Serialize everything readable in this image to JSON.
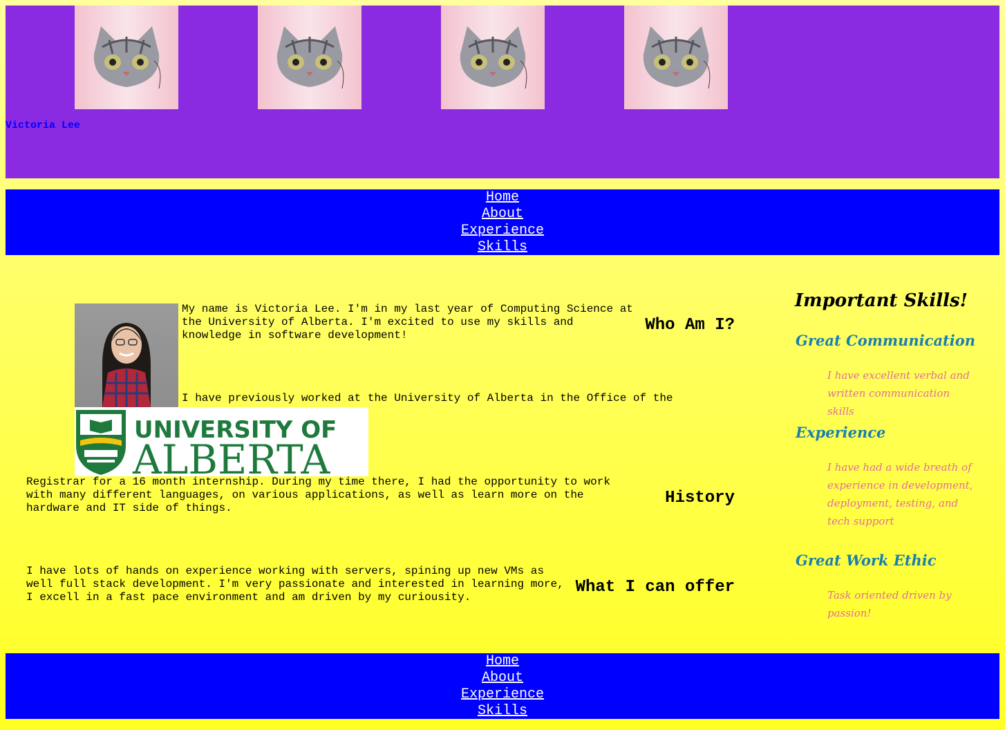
{
  "header": {
    "name": "Victoria Lee",
    "banner_images": [
      "cat-face-image",
      "cat-face-image",
      "cat-face-image",
      "cat-face-image"
    ]
  },
  "nav": {
    "items": [
      "Home",
      "About",
      "Experience",
      "Skills"
    ]
  },
  "about": {
    "heading": "Who Am I?",
    "text": "My name is Victoria Lee. I'm in my last year of Computing Science at the University of Alberta. I'm excited to use my skills and knowledge in software development!"
  },
  "history": {
    "heading": "History",
    "text_intro": "I have previously worked at the University of Alberta in the Office of the",
    "text_main": "Registrar for a 16 month internship. During my time there, I had the opportunity to work with many different languages, on various applications, as well as learn more on the hardware and IT side of things.",
    "logo_text_top": "UNIVERSITY OF",
    "logo_text_bottom": "ALBERTA"
  },
  "offer": {
    "heading": "What I can offer",
    "text": "I have lots of hands on experience working with servers, spining up new VMs as well full stack development. I'm very passionate and interested in learning more, I excell in a fast pace environment and am driven by my curiousity."
  },
  "skills": {
    "title": "Important Skills!",
    "items": [
      {
        "name": "Great Communication",
        "desc": "I have excellent verbal and written communication skills"
      },
      {
        "name": "Experience",
        "desc": "I have had a wide breath of experience in development, deployment, testing, and tech support"
      },
      {
        "name": "Great Work Ethic",
        "desc": "Task oriented driven by passion!"
      }
    ]
  },
  "colors": {
    "header_bg": "#8a2be2",
    "nav_bg": "#0000ff",
    "name_color": "#0000ff",
    "skill_name_color": "#1a7fb0",
    "skill_desc_color": "#e0709a"
  }
}
